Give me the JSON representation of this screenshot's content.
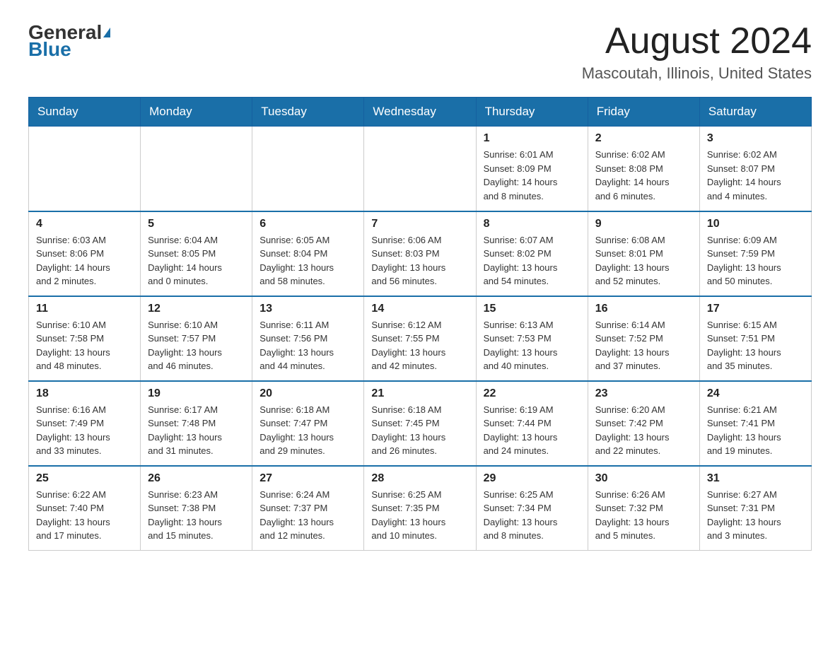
{
  "header": {
    "logo_general": "General",
    "logo_blue": "Blue",
    "month_title": "August 2024",
    "location": "Mascoutah, Illinois, United States"
  },
  "weekdays": [
    "Sunday",
    "Monday",
    "Tuesday",
    "Wednesday",
    "Thursday",
    "Friday",
    "Saturday"
  ],
  "weeks": [
    [
      {
        "day": "",
        "info": ""
      },
      {
        "day": "",
        "info": ""
      },
      {
        "day": "",
        "info": ""
      },
      {
        "day": "",
        "info": ""
      },
      {
        "day": "1",
        "info": "Sunrise: 6:01 AM\nSunset: 8:09 PM\nDaylight: 14 hours\nand 8 minutes."
      },
      {
        "day": "2",
        "info": "Sunrise: 6:02 AM\nSunset: 8:08 PM\nDaylight: 14 hours\nand 6 minutes."
      },
      {
        "day": "3",
        "info": "Sunrise: 6:02 AM\nSunset: 8:07 PM\nDaylight: 14 hours\nand 4 minutes."
      }
    ],
    [
      {
        "day": "4",
        "info": "Sunrise: 6:03 AM\nSunset: 8:06 PM\nDaylight: 14 hours\nand 2 minutes."
      },
      {
        "day": "5",
        "info": "Sunrise: 6:04 AM\nSunset: 8:05 PM\nDaylight: 14 hours\nand 0 minutes."
      },
      {
        "day": "6",
        "info": "Sunrise: 6:05 AM\nSunset: 8:04 PM\nDaylight: 13 hours\nand 58 minutes."
      },
      {
        "day": "7",
        "info": "Sunrise: 6:06 AM\nSunset: 8:03 PM\nDaylight: 13 hours\nand 56 minutes."
      },
      {
        "day": "8",
        "info": "Sunrise: 6:07 AM\nSunset: 8:02 PM\nDaylight: 13 hours\nand 54 minutes."
      },
      {
        "day": "9",
        "info": "Sunrise: 6:08 AM\nSunset: 8:01 PM\nDaylight: 13 hours\nand 52 minutes."
      },
      {
        "day": "10",
        "info": "Sunrise: 6:09 AM\nSunset: 7:59 PM\nDaylight: 13 hours\nand 50 minutes."
      }
    ],
    [
      {
        "day": "11",
        "info": "Sunrise: 6:10 AM\nSunset: 7:58 PM\nDaylight: 13 hours\nand 48 minutes."
      },
      {
        "day": "12",
        "info": "Sunrise: 6:10 AM\nSunset: 7:57 PM\nDaylight: 13 hours\nand 46 minutes."
      },
      {
        "day": "13",
        "info": "Sunrise: 6:11 AM\nSunset: 7:56 PM\nDaylight: 13 hours\nand 44 minutes."
      },
      {
        "day": "14",
        "info": "Sunrise: 6:12 AM\nSunset: 7:55 PM\nDaylight: 13 hours\nand 42 minutes."
      },
      {
        "day": "15",
        "info": "Sunrise: 6:13 AM\nSunset: 7:53 PM\nDaylight: 13 hours\nand 40 minutes."
      },
      {
        "day": "16",
        "info": "Sunrise: 6:14 AM\nSunset: 7:52 PM\nDaylight: 13 hours\nand 37 minutes."
      },
      {
        "day": "17",
        "info": "Sunrise: 6:15 AM\nSunset: 7:51 PM\nDaylight: 13 hours\nand 35 minutes."
      }
    ],
    [
      {
        "day": "18",
        "info": "Sunrise: 6:16 AM\nSunset: 7:49 PM\nDaylight: 13 hours\nand 33 minutes."
      },
      {
        "day": "19",
        "info": "Sunrise: 6:17 AM\nSunset: 7:48 PM\nDaylight: 13 hours\nand 31 minutes."
      },
      {
        "day": "20",
        "info": "Sunrise: 6:18 AM\nSunset: 7:47 PM\nDaylight: 13 hours\nand 29 minutes."
      },
      {
        "day": "21",
        "info": "Sunrise: 6:18 AM\nSunset: 7:45 PM\nDaylight: 13 hours\nand 26 minutes."
      },
      {
        "day": "22",
        "info": "Sunrise: 6:19 AM\nSunset: 7:44 PM\nDaylight: 13 hours\nand 24 minutes."
      },
      {
        "day": "23",
        "info": "Sunrise: 6:20 AM\nSunset: 7:42 PM\nDaylight: 13 hours\nand 22 minutes."
      },
      {
        "day": "24",
        "info": "Sunrise: 6:21 AM\nSunset: 7:41 PM\nDaylight: 13 hours\nand 19 minutes."
      }
    ],
    [
      {
        "day": "25",
        "info": "Sunrise: 6:22 AM\nSunset: 7:40 PM\nDaylight: 13 hours\nand 17 minutes."
      },
      {
        "day": "26",
        "info": "Sunrise: 6:23 AM\nSunset: 7:38 PM\nDaylight: 13 hours\nand 15 minutes."
      },
      {
        "day": "27",
        "info": "Sunrise: 6:24 AM\nSunset: 7:37 PM\nDaylight: 13 hours\nand 12 minutes."
      },
      {
        "day": "28",
        "info": "Sunrise: 6:25 AM\nSunset: 7:35 PM\nDaylight: 13 hours\nand 10 minutes."
      },
      {
        "day": "29",
        "info": "Sunrise: 6:25 AM\nSunset: 7:34 PM\nDaylight: 13 hours\nand 8 minutes."
      },
      {
        "day": "30",
        "info": "Sunrise: 6:26 AM\nSunset: 7:32 PM\nDaylight: 13 hours\nand 5 minutes."
      },
      {
        "day": "31",
        "info": "Sunrise: 6:27 AM\nSunset: 7:31 PM\nDaylight: 13 hours\nand 3 minutes."
      }
    ]
  ]
}
